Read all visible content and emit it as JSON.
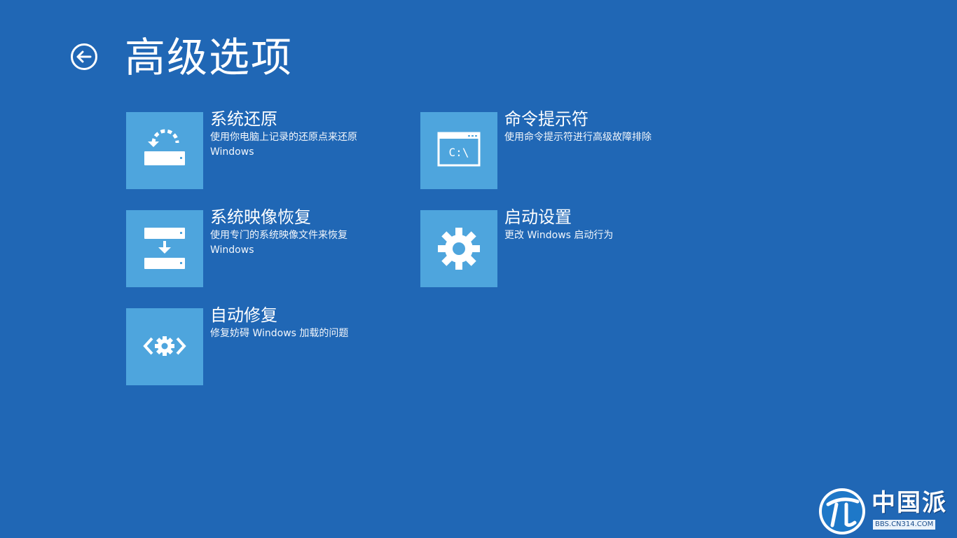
{
  "header": {
    "title": "高级选项",
    "back_icon": "back-arrow-circle-icon"
  },
  "colors": {
    "background": "#2067b5",
    "tile": "#4ea5dd",
    "text": "#ffffff"
  },
  "options": [
    {
      "icon": "system-restore-icon",
      "title": "系统还原",
      "desc_line1": "使用你电脑上记录的还原点来还原",
      "desc_line2": "Windows"
    },
    {
      "icon": "command-prompt-icon",
      "title": "命令提示符",
      "desc_line1": "使用命令提示符进行高级故障排除"
    },
    {
      "icon": "system-image-recovery-icon",
      "title": "系统映像恢复",
      "desc_line1": "使用专门的系统映像文件来恢复",
      "desc_line2": "Windows"
    },
    {
      "icon": "startup-settings-gear-icon",
      "title": "启动设置",
      "desc_line1": "更改 Windows 启动行为"
    },
    {
      "icon": "automatic-repair-icon",
      "title": "自动修复",
      "desc_line1": "修复妨碍 Windows 加载的问题"
    }
  ],
  "command_prompt_glyph": "C:\\",
  "watermark": {
    "logo_text": "中国派",
    "url": "BBS.CN314.COM"
  }
}
